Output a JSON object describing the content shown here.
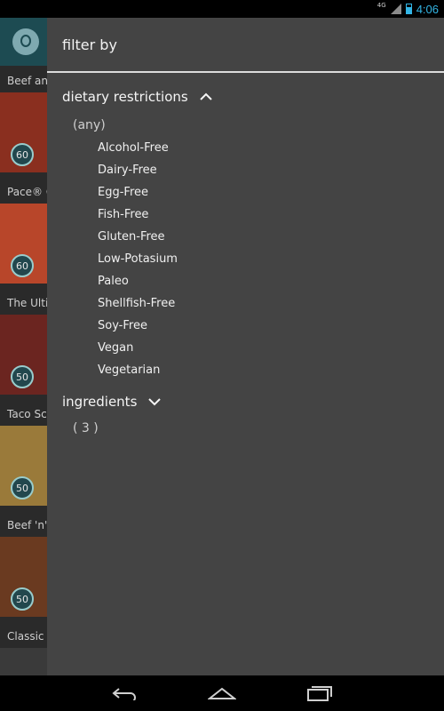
{
  "status_bar": {
    "network": "4G",
    "time": "4:06"
  },
  "background_list": {
    "items": [
      {
        "title": "Beef an",
        "minutes": "60",
        "color": "#8a2f1f"
      },
      {
        "title": "Pace® G",
        "minutes": "60",
        "color": "#b8462a"
      },
      {
        "title": "The Ulti",
        "minutes": "50",
        "color": "#6b2520"
      },
      {
        "title": "Taco Sc",
        "minutes": "50",
        "color": "#9a7a3a"
      },
      {
        "title": "Beef 'n'",
        "minutes": "50",
        "color": "#6a3a20"
      },
      {
        "title": "Classic I",
        "minutes": "",
        "color": "#3a3a3a"
      }
    ]
  },
  "drawer": {
    "title": "filter by",
    "dietary": {
      "label": "dietary restrictions",
      "selected": "(any)",
      "options": [
        "Alcohol-Free",
        "Dairy-Free",
        "Egg-Free",
        "Fish-Free",
        "Gluten-Free",
        "Low-Potasium",
        "Paleo",
        "Shellfish-Free",
        "Soy-Free",
        "Vegan",
        "Vegetarian"
      ]
    },
    "ingredients": {
      "label": "ingredients",
      "count": "( 3 )"
    }
  },
  "colors": {
    "drawer_bg": "#444444",
    "accent": "#33b5e5",
    "app_bar": "#1d4b52"
  }
}
